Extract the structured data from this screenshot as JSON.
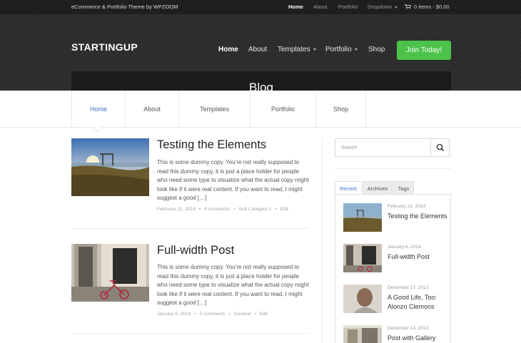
{
  "topbar": {
    "tagline": "eCommerce & Portfolio Theme by WPZOOM",
    "nav": [
      {
        "label": "Home",
        "active": true
      },
      {
        "label": "About"
      },
      {
        "label": "Portfolio"
      },
      {
        "label": "Dropdown",
        "has_caret": true
      }
    ],
    "cart": "0 items - $0.00"
  },
  "header": {
    "logo": "STARTINGUP",
    "nav": [
      {
        "label": "Home",
        "active": true
      },
      {
        "label": "About"
      },
      {
        "label": "Templates",
        "has_caret": true
      },
      {
        "label": "Portfolio",
        "has_caret": true
      },
      {
        "label": "Shop"
      }
    ],
    "cta": "Join Today!",
    "page_title": "Blog"
  },
  "subnav": [
    {
      "label": "Home",
      "active": true
    },
    {
      "label": "About"
    },
    {
      "label": "Templates"
    },
    {
      "label": "Portfolio"
    },
    {
      "label": "Shop"
    }
  ],
  "posts": [
    {
      "title": "Testing the Elements",
      "excerpt": "This is some dummy copy. You’re not really supposed to read this dummy copy, it is just a place holder for people who need some type to visualize what the actual copy might look like if it were real content. If you want to read, I might suggest a good […]",
      "date": "February 21, 2014",
      "comments": "4 comments",
      "category": "Sub Category 1",
      "edit": "Edit"
    },
    {
      "title": "Full-width Post",
      "excerpt": "This is some dummy copy. You’re not really supposed to read this dummy copy, it is just a place holder for people who need some type to visualize what the actual copy might look like if it were real content. If you want to read, I might suggest a good […]",
      "date": "January 6, 2014",
      "comments": "0 comments",
      "category": "General",
      "edit": "Edit"
    }
  ],
  "sidebar": {
    "search_placeholder": "Search",
    "tabs": [
      {
        "label": "Recent",
        "active": true
      },
      {
        "label": "Archives"
      },
      {
        "label": "Tags"
      }
    ],
    "recent": [
      {
        "date": "February 21, 2014",
        "title": "Testing the Elements"
      },
      {
        "date": "January 6, 2014",
        "title": "Full-width Post"
      },
      {
        "date": "December 17, 2013",
        "title": "A Good Life, Too: Alonzo Clemons"
      },
      {
        "date": "December 13, 2013",
        "title": "Post with Gallery"
      }
    ]
  },
  "colors": {
    "accent": "#3b73c7",
    "cta": "#4cc24a",
    "header_bg": "#2b2b2b",
    "topbar_bg": "#1f1f1f"
  }
}
